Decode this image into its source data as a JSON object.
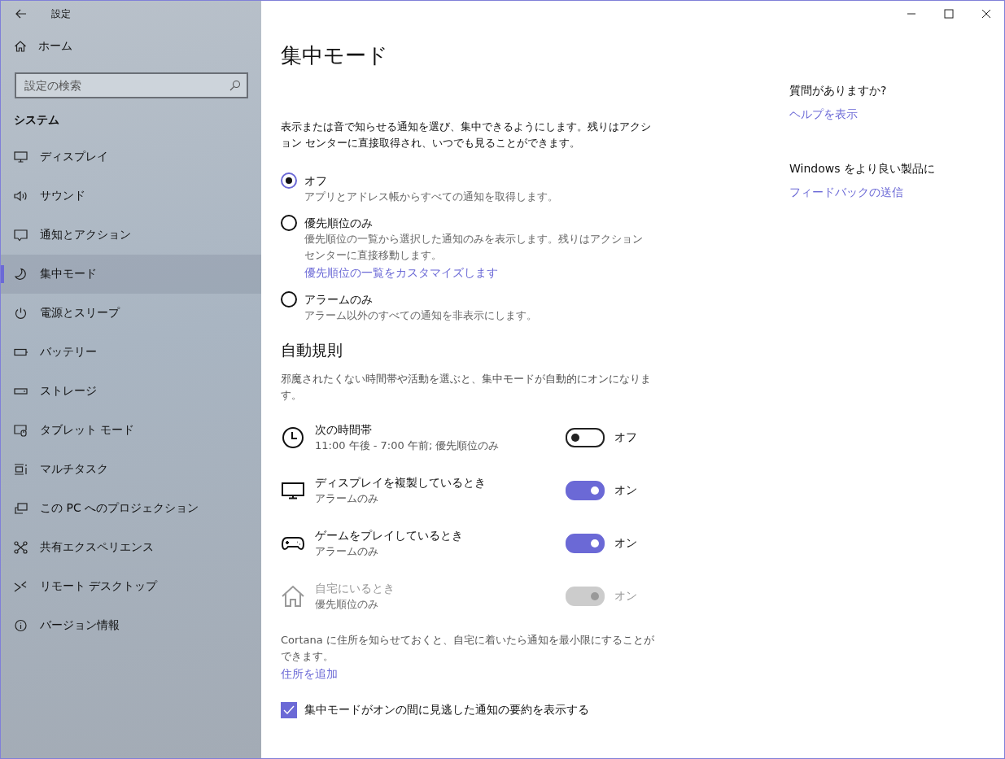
{
  "window": {
    "title": "設定"
  },
  "sidebar": {
    "home": "ホーム",
    "search": {
      "placeholder": "設定の検索"
    },
    "section": "システム",
    "items": [
      {
        "label": "ディスプレイ",
        "selected": false
      },
      {
        "label": "サウンド",
        "selected": false
      },
      {
        "label": "通知とアクション",
        "selected": false
      },
      {
        "label": "集中モード",
        "selected": true
      },
      {
        "label": "電源とスリープ",
        "selected": false
      },
      {
        "label": "バッテリー",
        "selected": false
      },
      {
        "label": "ストレージ",
        "selected": false
      },
      {
        "label": "タブレット モード",
        "selected": false
      },
      {
        "label": "マルチタスク",
        "selected": false
      },
      {
        "label": "この PC へのプロジェクション",
        "selected": false
      },
      {
        "label": "共有エクスペリエンス",
        "selected": false
      },
      {
        "label": "リモート デスクトップ",
        "selected": false
      },
      {
        "label": "バージョン情報",
        "selected": false
      }
    ]
  },
  "page": {
    "title": "集中モード",
    "description": "表示または音で知らせる通知を選び、集中できるようにします。残りはアクション センターに直接取得され、いつでも見ることができます。",
    "options": [
      {
        "label": "オフ",
        "description": "アプリとアドレス帳からすべての通知を取得します。",
        "selected": true
      },
      {
        "label": "優先順位のみ",
        "description": "優先順位の一覧から選択した通知のみを表示します。残りはアクションセンターに直接移動します。",
        "link": "優先順位の一覧をカスタマイズします",
        "selected": false
      },
      {
        "label": "アラームのみ",
        "description": "アラーム以外のすべての通知を非表示にします。",
        "selected": false
      }
    ],
    "auto_rules": {
      "heading": "自動規則",
      "description": "邪魔されたくない時間帯や活動を選ぶと、集中モードが自動的にオンになります。",
      "rules": [
        {
          "title": "次の時間帯",
          "subtitle": "11:00 午後 - 7:00 午前; 優先順位のみ",
          "on": false,
          "state_label": "オフ",
          "disabled": false
        },
        {
          "title": "ディスプレイを複製しているとき",
          "subtitle": "アラームのみ",
          "on": true,
          "state_label": "オン",
          "disabled": false
        },
        {
          "title": "ゲームをプレイしているとき",
          "subtitle": "アラームのみ",
          "on": true,
          "state_label": "オン",
          "disabled": false
        },
        {
          "title": "自宅にいるとき",
          "subtitle": "優先順位のみ",
          "on": true,
          "state_label": "オン",
          "disabled": true
        }
      ]
    },
    "cortana_note": "Cortana に住所を知らせておくと、自宅に着いたら通知を最小限にすることができます。",
    "add_address_link": "住所を追加",
    "summary_checkbox": {
      "label": "集中モードがオンの間に見逃した通知の要約を表示する",
      "checked": true
    }
  },
  "help": {
    "question": "質問がありますか?",
    "help_link": "ヘルプを表示",
    "feedback_heading": "Windows をより良い製品に",
    "feedback_link": "フィードバックの送信"
  }
}
